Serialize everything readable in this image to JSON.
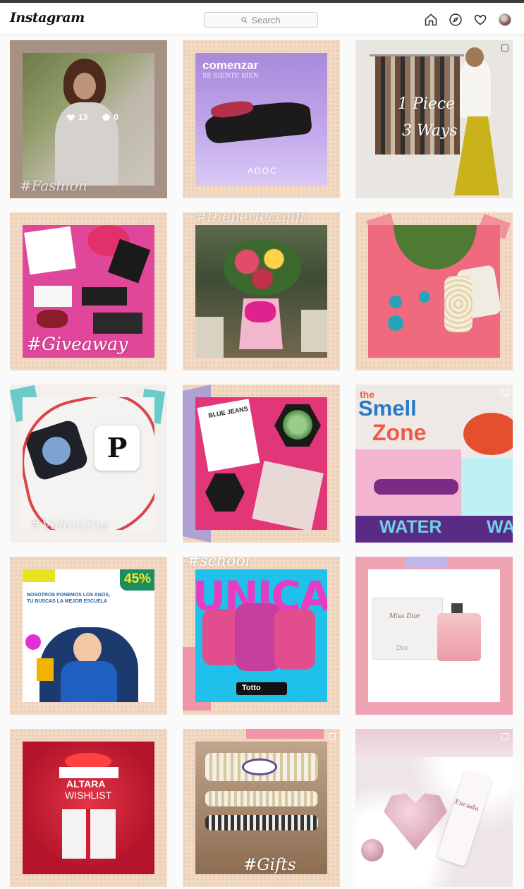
{
  "app": {
    "logo": "Instagram"
  },
  "search": {
    "placeholder": "Search"
  },
  "nav": {
    "icons": [
      "home-icon",
      "explore-icon",
      "heart-icon",
      "profile-avatar"
    ]
  },
  "posts": {
    "p1": {
      "caption": "#Fashion",
      "likes": "13",
      "comments": "0"
    },
    "p2": {
      "headline": "comenzar",
      "subline": "SE SIENTE BIEN",
      "brand": "ADOC"
    },
    "p3": {
      "caption_line1": "1 Piece",
      "caption_line2": "3 Ways"
    },
    "p4": {
      "caption": "#Giveaway"
    },
    "p5": {
      "caption": "#theperfectgift"
    },
    "p6": {},
    "p7": {
      "caption": "#Valentine"
    },
    "p8": {
      "book_title": "BLUE JEANS"
    },
    "p9": {
      "line1": "the",
      "line2": "Smell",
      "line3": "Zone",
      "line4": "WATER",
      "line5": "WA"
    },
    "p10": {
      "badge": "45%",
      "headline": "NOSOTROS PONEMOS LOS ANOS, TU BUSCAS LA MEJOR ESCUELA"
    },
    "p11": {
      "hashtag": "#school",
      "big": "UNICA",
      "brand": "Totto"
    },
    "p12": {
      "product": "Miss Dior",
      "brand": "Dior"
    },
    "p13": {
      "title": "ALTARA",
      "subtitle": "WISHLIST"
    },
    "p14": {
      "caption": "#Gifts"
    },
    "p15": {
      "brand": "Escada"
    }
  },
  "colors": {
    "accent_pink": "#e83e8c",
    "frame_peach": "#f1d9c4",
    "header_border": "#dbdbdb"
  }
}
